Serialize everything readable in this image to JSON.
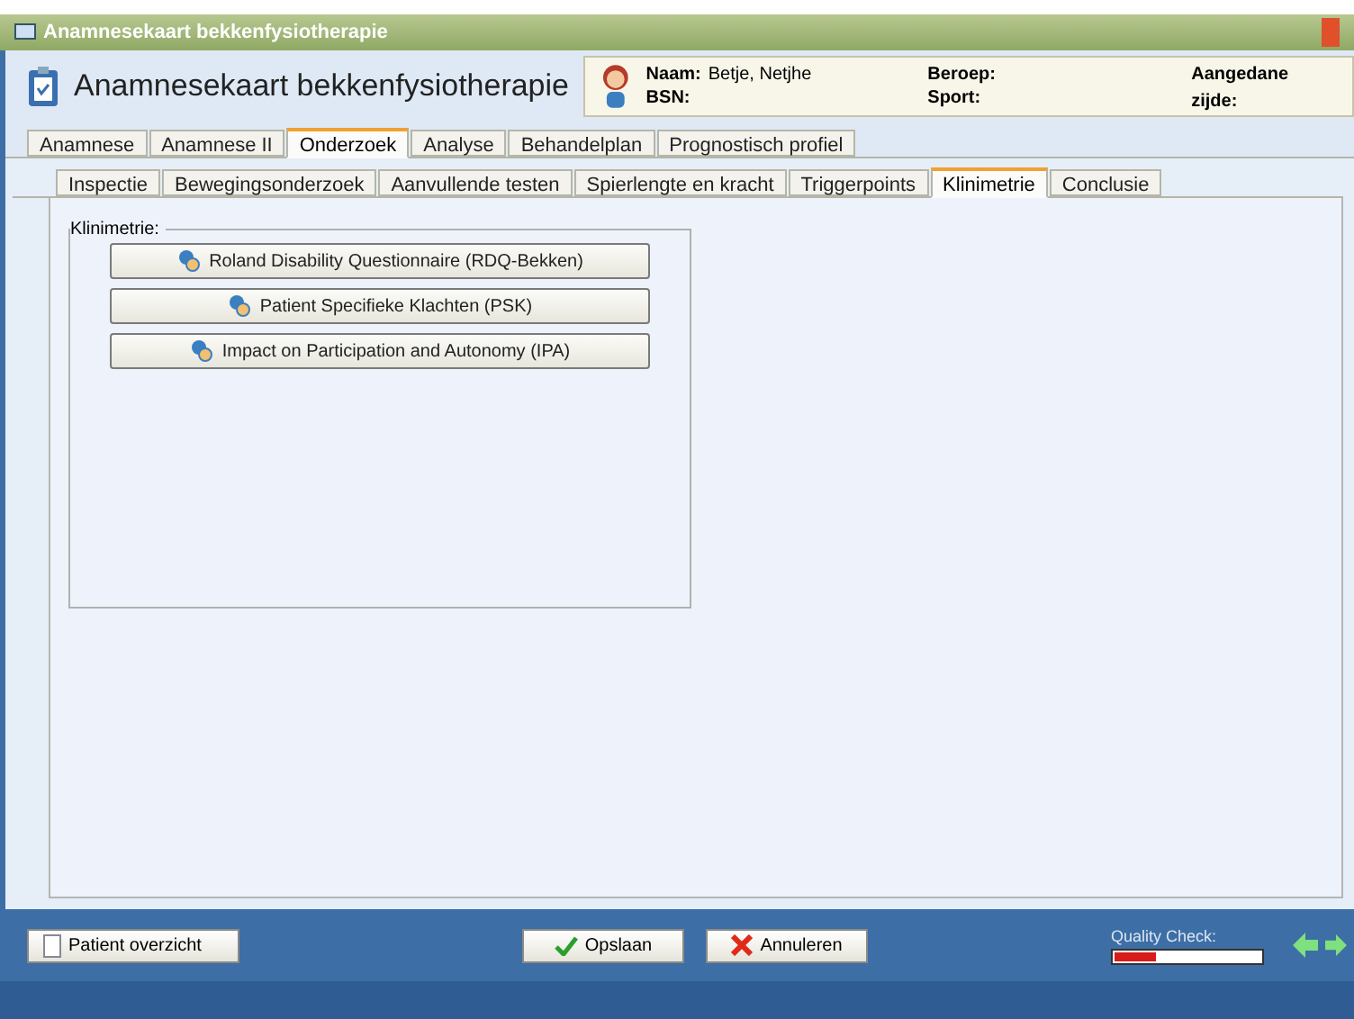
{
  "window": {
    "title": "Anamnesekaart bekkenfysiotherapie"
  },
  "header": {
    "title": "Anamnesekaart bekkenfysiotherapie",
    "fields": [
      {
        "label": "Naam:",
        "value": "Betje, Netjhe"
      },
      {
        "label": "BSN:"
      },
      {
        "label": "Beroep:"
      },
      {
        "label": "Sport:"
      },
      {
        "label": "Aangedane zijde:"
      }
    ]
  },
  "tabs": [
    {
      "label": "Anamnese",
      "selected": false
    },
    {
      "label": "Anamnese II",
      "selected": false
    },
    {
      "label": "Onderzoek",
      "selected": true
    },
    {
      "label": "Analyse",
      "selected": false
    },
    {
      "label": "Behandelplan",
      "selected": false
    },
    {
      "label": "Prognostisch profiel",
      "selected": false
    }
  ],
  "subtabs": [
    {
      "label": "Inspectie",
      "selected": false
    },
    {
      "label": "Bewegingsonderzoek",
      "selected": false
    },
    {
      "label": "Aanvullende testen",
      "selected": false
    },
    {
      "label": "Spierlengte en kracht",
      "selected": false
    },
    {
      "label": "Triggerpoints",
      "selected": false
    },
    {
      "label": "Klinimetrie",
      "selected": true
    },
    {
      "label": "Conclusie",
      "selected": false
    }
  ],
  "group": {
    "title": "Klinimetrie:",
    "buttons": [
      "Roland Disability Questionnaire (RDQ-Bekken)",
      "Patient Specifieke Klachten (PSK)",
      "Impact on Participation and Autonomy (IPA)"
    ]
  },
  "footer": {
    "overview": "Patient overzicht",
    "save": "Opslaan",
    "cancel": "Annuleren",
    "quality_label": "Quality Check:",
    "quality": {
      "level": 0.28
    }
  }
}
